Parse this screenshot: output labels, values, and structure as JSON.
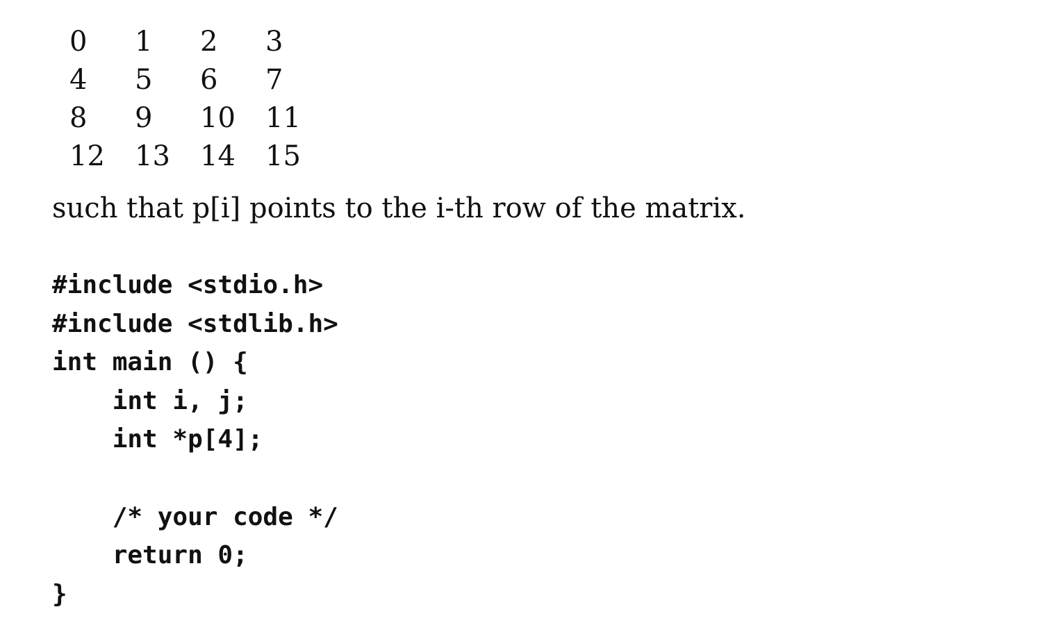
{
  "matrix": {
    "rows": [
      [
        "0",
        "1",
        "2",
        "3"
      ],
      [
        "4",
        "5",
        "6",
        "7"
      ],
      [
        "8",
        "9",
        "10",
        "11"
      ],
      [
        "12",
        "13",
        "14",
        "15"
      ]
    ]
  },
  "prose": {
    "sentence": "such that p[i] points to the i-th row of the matrix."
  },
  "code": {
    "lines": [
      "#include <stdio.h>",
      "#include <stdlib.h>",
      "int main () {",
      "    int i, j;",
      "    int *p[4];",
      "",
      "    /* your code */",
      "    return 0;",
      "}"
    ]
  }
}
